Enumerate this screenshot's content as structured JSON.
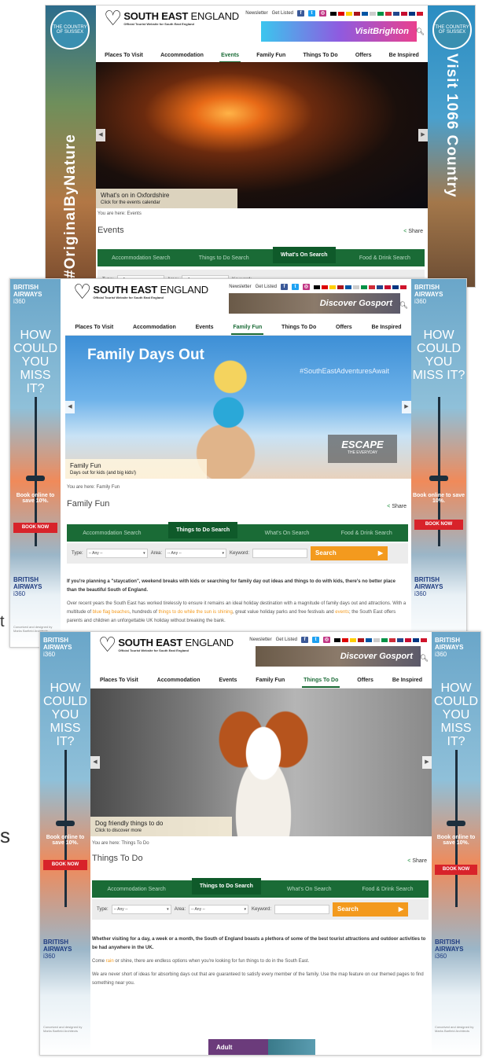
{
  "common": {
    "logo": {
      "main_bold": "SOUTH EAST",
      "main_light": "ENGLAND",
      "tagline": "Official Tourist Website for South East England"
    },
    "newsletter": "Newsletter",
    "get_listed": "Get Listed",
    "social": [
      {
        "icon": "facebook-icon",
        "glyph": "f",
        "color": "#3b5998"
      },
      {
        "icon": "twitter-icon",
        "glyph": "t",
        "color": "#1da1f2"
      },
      {
        "icon": "instagram-icon",
        "glyph": "◎",
        "color": "#c13584"
      }
    ],
    "flag_colors": [
      "#000000",
      "#dd0000",
      "#ffce00",
      "#aa151b",
      "#0055a4",
      "#cccccc",
      "#009246",
      "#ce2b37",
      "#21468b",
      "#c60c30",
      "#003580",
      "#cf142b"
    ],
    "search_icon": "magnifier-icon",
    "nav": [
      "Places To Visit",
      "Accommodation",
      "Events",
      "Family Fun",
      "Things To Do",
      "Offers",
      "Be Inspired"
    ],
    "tabs": [
      "Accommodation Search",
      "Things to Do Search",
      "What's On Search",
      "Food & Drink Search"
    ],
    "share": "Share",
    "search_form": {
      "type_label": "Type:",
      "any": "-- Any --",
      "area_label": "Area:",
      "keyword_label": "Keyword:",
      "button": "Search",
      "button_arrow": "▶"
    },
    "arrow_left": "◀",
    "arrow_right": "▶",
    "accent": "#1a6b36",
    "orange": "#f39a1e"
  },
  "shot1": {
    "left_banner": {
      "seal": "THE COUNTRY OF SUSSEX",
      "text": "#OriginalByNature"
    },
    "right_banner": {
      "seal": "THE COUNTRY OF SUSSEX",
      "text": "Visit 1066 Country"
    },
    "ad": "VisitBrighton",
    "active_nav": "Events",
    "caption_title": "What's on in Oxfordshire",
    "caption_sub": "Click for the events calendar",
    "breadcrumb": "You are here: Events",
    "page_title": "Events",
    "active_tab": "What's On Search"
  },
  "shot2": {
    "ba": {
      "brand": "BRITISH AIRWAYS",
      "sub": "i360",
      "headline": "HOW COULD YOU MISS IT?",
      "book": "Book online to save 10%.",
      "button": "BOOK NOW",
      "foot": "Conceived and designed by Marks Barfield Architects"
    },
    "ad": "Discover Gosport",
    "active_nav": "Family Fun",
    "hero_title": "Family Days Out",
    "hero_tag": "#SouthEastAdventuresAwait",
    "escape": "ESCAPE",
    "escape_sub": "THE EVERYDAY",
    "caption_title": "Family Fun",
    "caption_sub": "Days out for kids (and big kids!)",
    "breadcrumb": "You are here: Family Fun",
    "page_title": "Family Fun",
    "active_tab": "Things to Do Search",
    "intro": "If you're planning a \"staycation\", weekend breaks with kids or searching for family day out ideas and things to do with kids, there's no better place than the beautiful South of England.",
    "p2a": "Over recent years the South East has worked tirelessly to ensure it remains an ideal holiday destination with a magnitude of family days out and attractions. With a multitude of ",
    "link1": "blue flag beaches",
    "p2b": ", hundreds of ",
    "link2": "things to do while the sun is shining",
    "p2c": ", great value holiday parks and free festivals and ",
    "link3": "events",
    "p2d": "; the South East offers parents and children an unforgettable UK holiday without breaking the bank."
  },
  "shot3": {
    "ad": "Discover Gosport",
    "active_nav": "Things To Do",
    "caption_title": "Dog friendly things to do",
    "caption_sub": "Click to discover more",
    "breadcrumb": "You are here: Things To Do",
    "page_title": "Things To Do",
    "active_tab": "Things to Do Search",
    "intro_a": "Whether visiting for a day, a week or a month, the South of England boasts a plethora of some of the best tourist ",
    "intro_link1": "attractions",
    "intro_b": " and ",
    "intro_link2": "outdoor activities",
    "intro_c": " to be had anywhere in the UK.",
    "p2a": "Come ",
    "p2link": "rain",
    "p2b": " or shine, there are endless options when you're looking for fun things to do in the South East.",
    "p3": "We are never short of ideas for absorbing days out that are guaranteed to satisfy every member of the family. Use the map feature on our themed pages to find something near you.",
    "adult": "Adult"
  },
  "peek_letters": {
    "t1": "t",
    "t2": "s"
  }
}
